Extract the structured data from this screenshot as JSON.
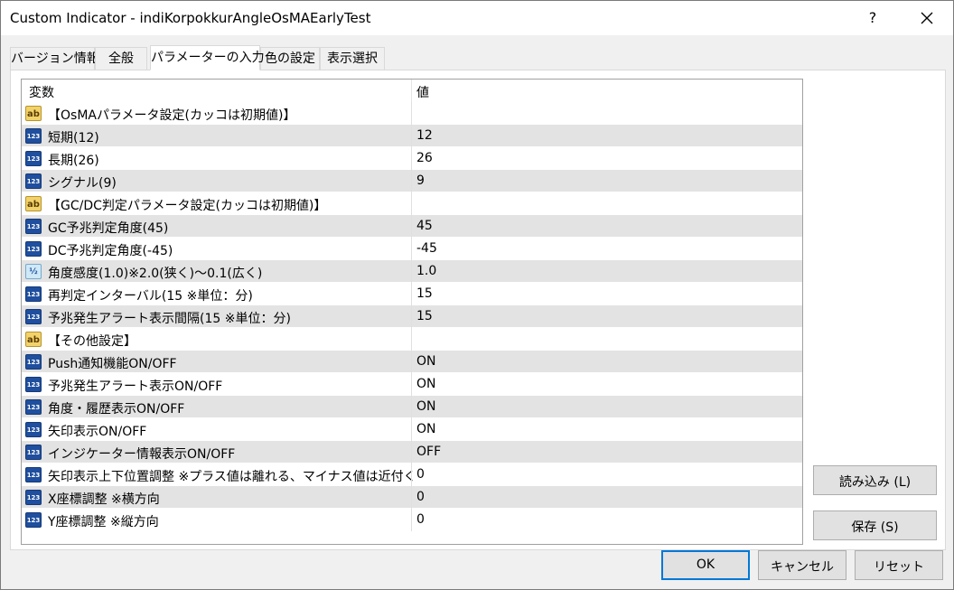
{
  "window": {
    "title": "Custom Indicator - indiKorpokkurAngleOsMAEarlyTest",
    "help": "?",
    "close_icon": "close-icon"
  },
  "tabs": [
    {
      "label": "バージョン情報",
      "active": false
    },
    {
      "label": "全般",
      "active": false
    },
    {
      "label": "パラメーターの入力",
      "active": true
    },
    {
      "label": "色の設定",
      "active": false
    },
    {
      "label": "表示選択",
      "active": false
    }
  ],
  "grid": {
    "header_variable": "変数",
    "header_value": "値",
    "rows": [
      {
        "type": "ab",
        "icon": "ab",
        "name": "【OsMAパラメータ設定(カッコは初期値)】",
        "value": ""
      },
      {
        "type": "123",
        "icon": "123",
        "name": "短期(12)",
        "value": "12"
      },
      {
        "type": "123",
        "icon": "123",
        "name": "長期(26)",
        "value": "26"
      },
      {
        "type": "123",
        "icon": "123",
        "name": "シグナル(9)",
        "value": "9"
      },
      {
        "type": "ab",
        "icon": "ab",
        "name": "【GC/DC判定パラメータ設定(カッコは初期値)】",
        "value": ""
      },
      {
        "type": "123",
        "icon": "123",
        "name": "GC予兆判定角度(45)",
        "value": "45"
      },
      {
        "type": "123",
        "icon": "123",
        "name": "DC予兆判定角度(-45)",
        "value": "-45"
      },
      {
        "type": "half",
        "icon": "½",
        "name": "角度感度(1.0)※2.0(狭く)～0.1(広く)",
        "value": "1.0"
      },
      {
        "type": "123",
        "icon": "123",
        "name": "再判定インターバル(15 ※単位：分)",
        "value": "15"
      },
      {
        "type": "123",
        "icon": "123",
        "name": "予兆発生アラート表示間隔(15 ※単位：分)",
        "value": "15"
      },
      {
        "type": "ab",
        "icon": "ab",
        "name": "【その他設定】",
        "value": ""
      },
      {
        "type": "123",
        "icon": "123",
        "name": "Push通知機能ON/OFF",
        "value": "ON"
      },
      {
        "type": "123",
        "icon": "123",
        "name": "予兆発生アラート表示ON/OFF",
        "value": "ON"
      },
      {
        "type": "123",
        "icon": "123",
        "name": "角度・履歴表示ON/OFF",
        "value": "ON"
      },
      {
        "type": "123",
        "icon": "123",
        "name": "矢印表示ON/OFF",
        "value": "ON"
      },
      {
        "type": "123",
        "icon": "123",
        "name": "インジケーター情報表示ON/OFF",
        "value": "OFF"
      },
      {
        "type": "123",
        "icon": "123",
        "name": "矢印表示上下位置調整 ※プラス値は離れる、マイナス値は近付く",
        "value": "0"
      },
      {
        "type": "123",
        "icon": "123",
        "name": "X座標調整 ※横方向",
        "value": "0"
      },
      {
        "type": "123",
        "icon": "123",
        "name": "Y座標調整 ※縦方向",
        "value": "0"
      }
    ]
  },
  "buttons": {
    "load": "読み込み (L)",
    "save": "保存 (S)",
    "ok": "OK",
    "cancel": "キャンセル",
    "reset": "リセット"
  },
  "colors": {
    "accent": "#0078d7",
    "row_alt": "#e3e3e3"
  }
}
